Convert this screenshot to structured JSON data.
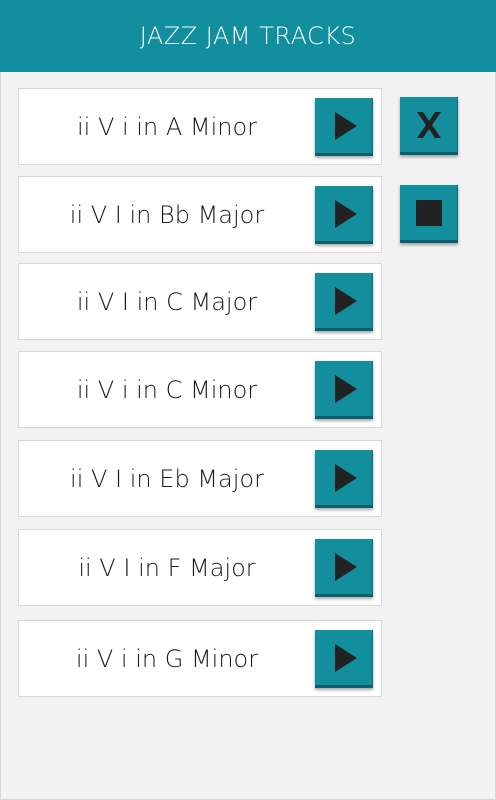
{
  "header": {
    "title": "JAZZ JAM TRACKS"
  },
  "tracks": [
    {
      "label": "ii V i in A Minor"
    },
    {
      "label": "ii V I in Bb Major"
    },
    {
      "label": "ii V I in C Major"
    },
    {
      "label": "ii V i in C Minor"
    },
    {
      "label": "ii V I in Eb Major"
    },
    {
      "label": "ii V I in F Major"
    },
    {
      "label": "ii V i in G Minor"
    }
  ],
  "icons": {
    "track_button": "play-icon",
    "close_button": "close-icon",
    "stop_button": "stop-icon"
  },
  "colors": {
    "accent": "#118f9f",
    "button": "#128e9c",
    "icon": "#222222",
    "background": "#f2f2f2"
  }
}
